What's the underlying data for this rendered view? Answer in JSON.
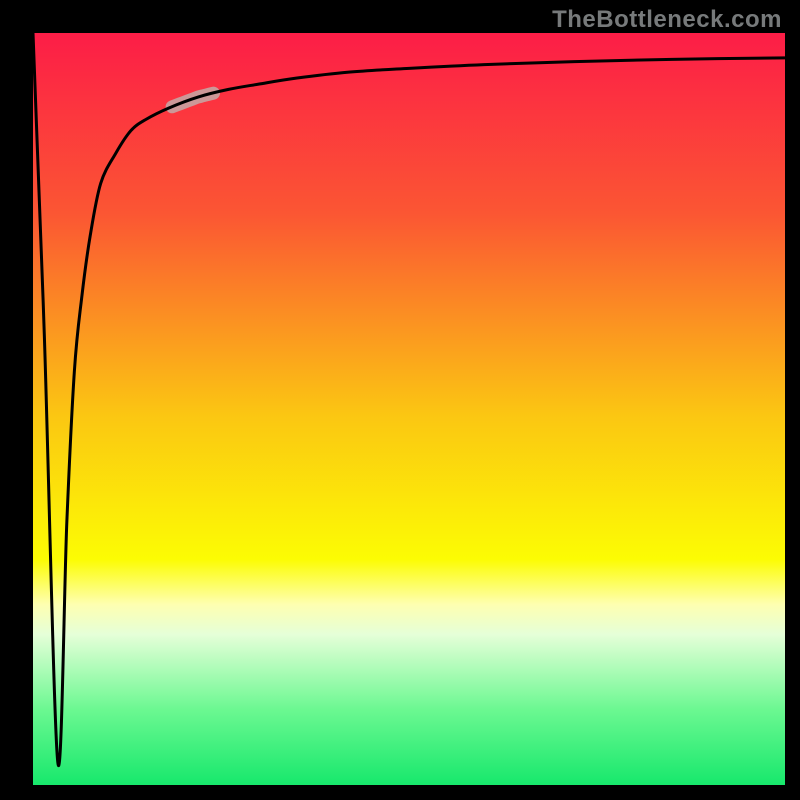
{
  "watermark": "TheBottleneck.com",
  "chart_data": {
    "type": "line",
    "title": "",
    "xlabel": "",
    "ylabel": "",
    "xlim": [
      0,
      100
    ],
    "ylim": [
      0,
      100
    ],
    "grid": false,
    "legend": false,
    "series": [
      {
        "name": "bottleneck-curve",
        "x": [
          0,
          1.5,
          3.3,
          4.5,
          5.5,
          6.5,
          7.6,
          9,
          11,
          13,
          15,
          18,
          22,
          26,
          30,
          35,
          42,
          50,
          60,
          72,
          85,
          100
        ],
        "values": [
          100,
          60,
          3,
          35,
          55,
          65,
          73,
          80,
          84,
          87,
          88.5,
          90,
          91.5,
          92.5,
          93.2,
          94,
          94.8,
          95.3,
          95.8,
          96.2,
          96.5,
          96.7
        ]
      }
    ],
    "gradient_stops": [
      {
        "pos": 0.0,
        "color": "#fc1d47"
      },
      {
        "pos": 0.24,
        "color": "#fb5633"
      },
      {
        "pos": 0.51,
        "color": "#fbc712"
      },
      {
        "pos": 0.7,
        "color": "#fcfc03"
      },
      {
        "pos": 0.76,
        "color": "#feffb1"
      },
      {
        "pos": 0.8,
        "color": "#e5ffd8"
      },
      {
        "pos": 0.9,
        "color": "#6bf891"
      },
      {
        "pos": 1.0,
        "color": "#17e86c"
      }
    ],
    "highlight_segment": {
      "series": "bottleneck-curve",
      "x_start": 18.5,
      "x_end": 24,
      "color": "#cc9898",
      "width": 13
    }
  }
}
